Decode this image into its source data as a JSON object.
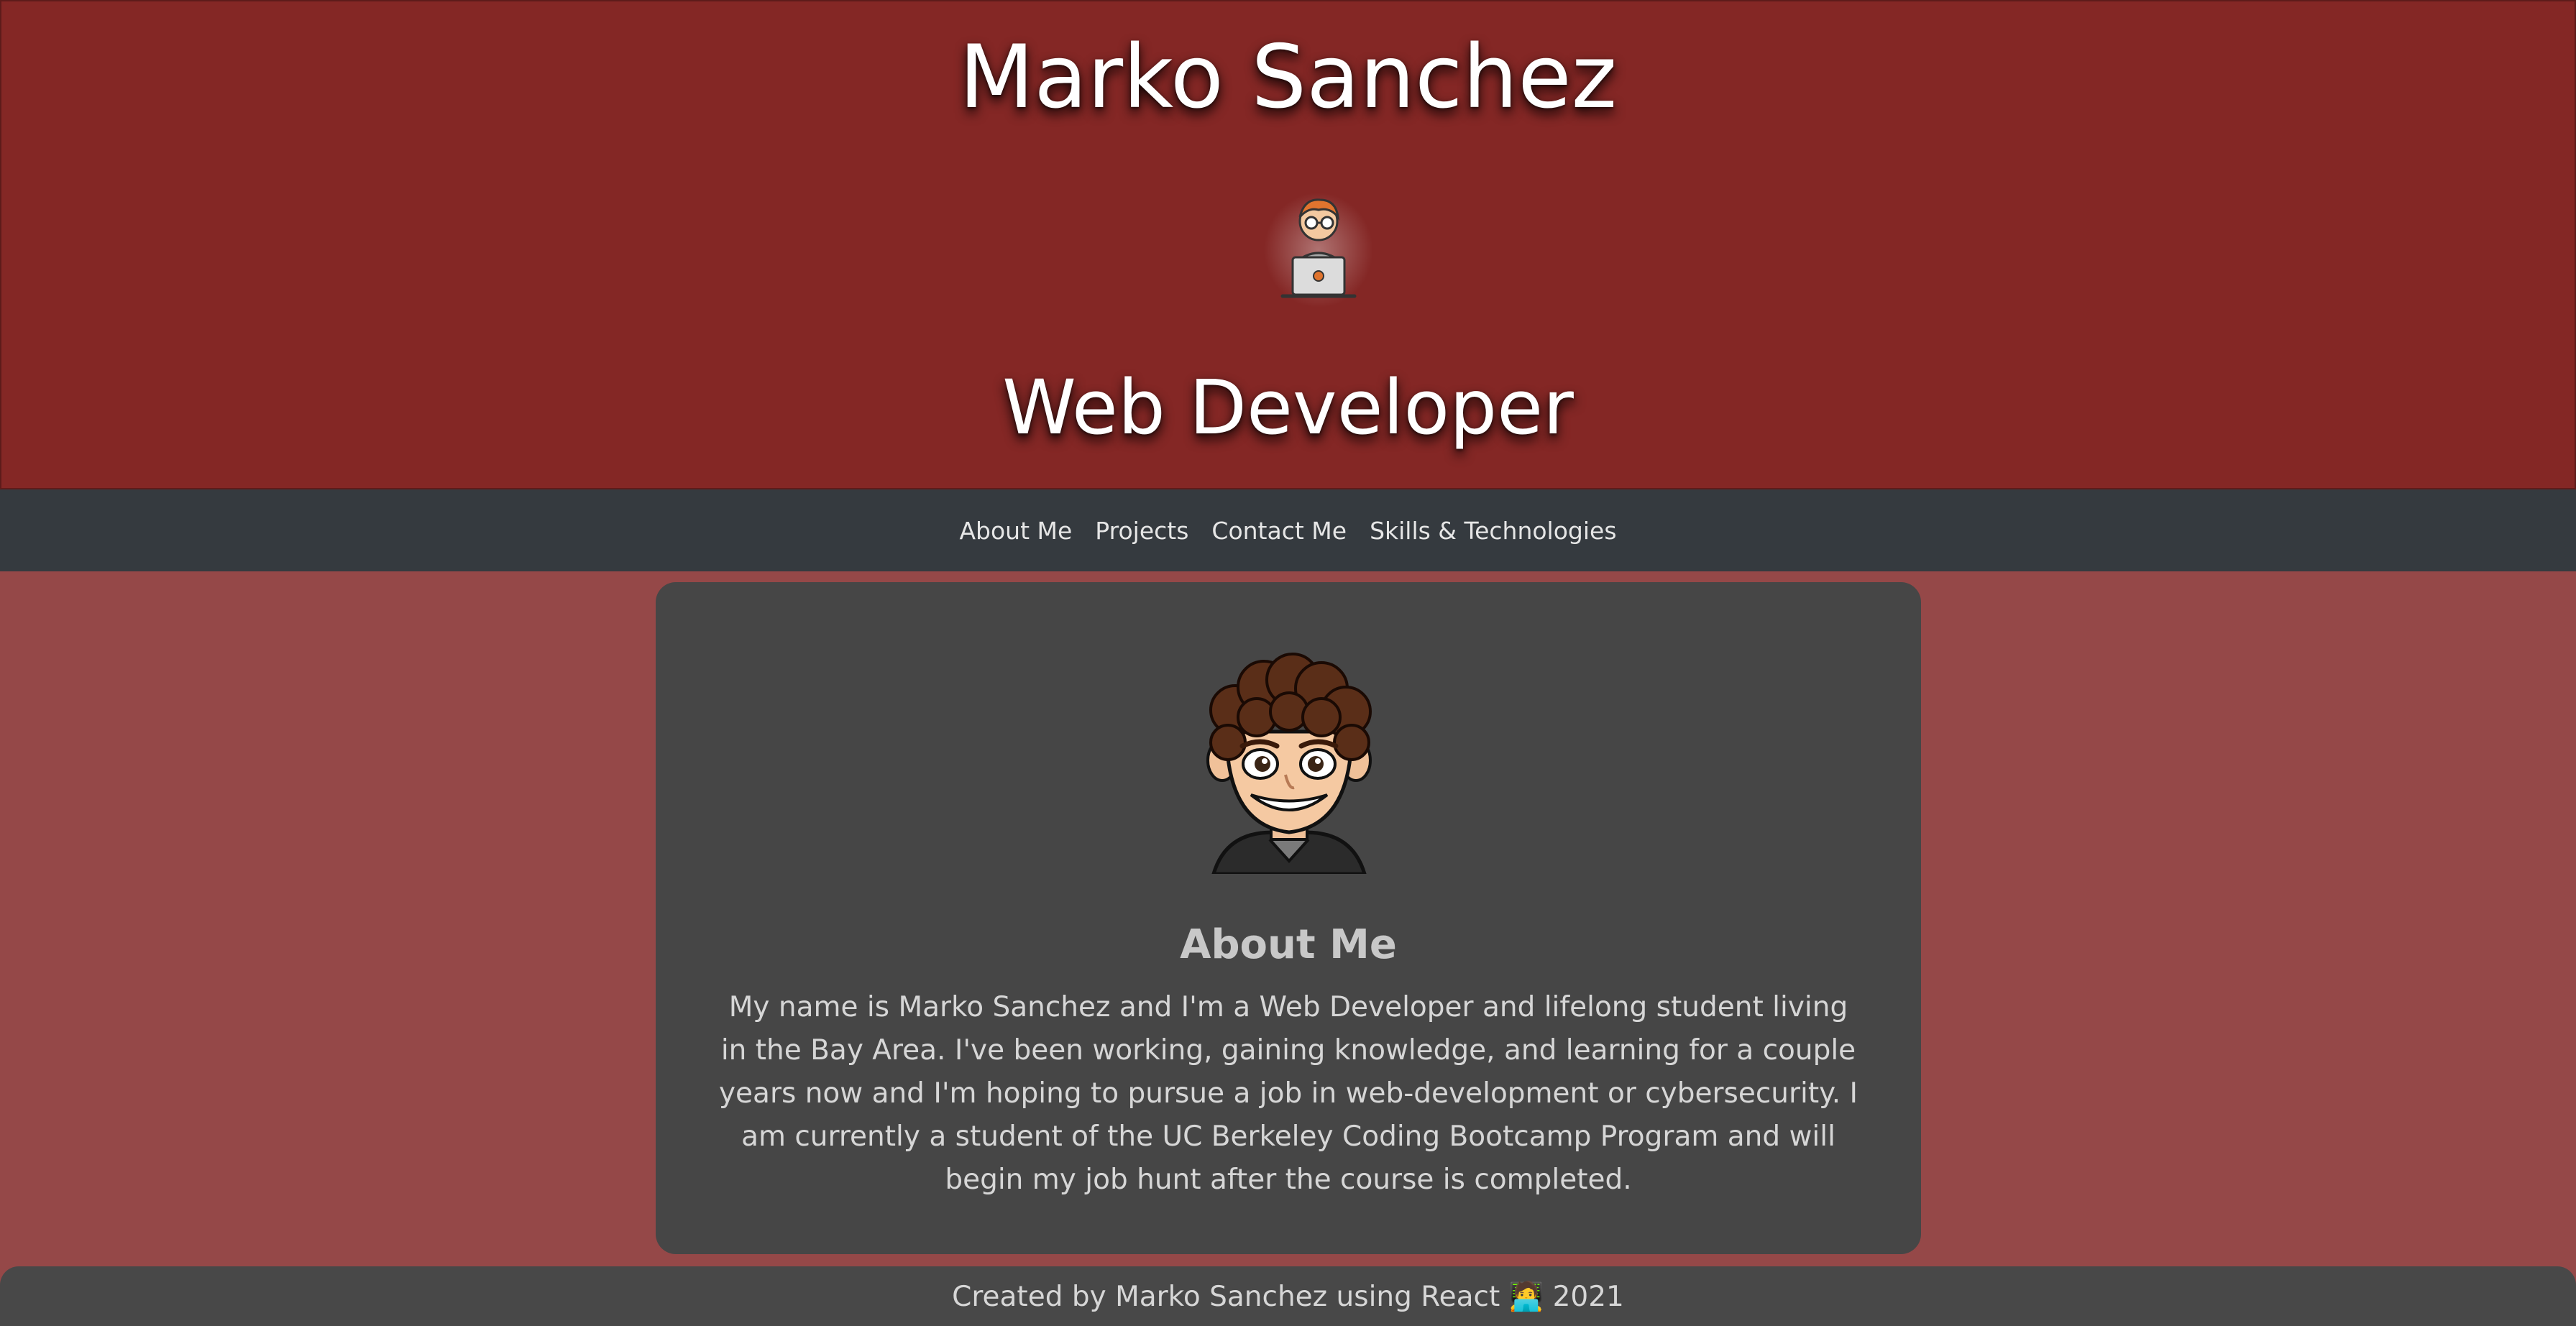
{
  "header": {
    "title": "Marko Sanchez",
    "subtitle": "Web Developer",
    "avatar_icon": "developer-laptop-icon"
  },
  "nav": {
    "items": [
      {
        "label": "About Me"
      },
      {
        "label": "Projects"
      },
      {
        "label": "Contact Me"
      },
      {
        "label": "Skills & Technologies"
      }
    ]
  },
  "about": {
    "avatar_icon": "bitmoji-avatar-icon",
    "title": "About Me",
    "text": "My name is Marko Sanchez and I'm a Web Developer and lifelong student living in the Bay Area. I've been working, gaining knowledge, and learning for a couple years now and I'm hoping to pursue a job in web-development or cybersecurity. I am currently a student of the UC Berkeley Coding Bootcamp Program and will begin my job hunt after the course is completed."
  },
  "footer": {
    "text": "Created by Marko Sanchez using React 🧑‍💻 2021"
  },
  "colors": {
    "header_bg": "#842725",
    "nav_bg": "#353a3f",
    "page_bg": "#954848",
    "card_bg": "#464646"
  }
}
